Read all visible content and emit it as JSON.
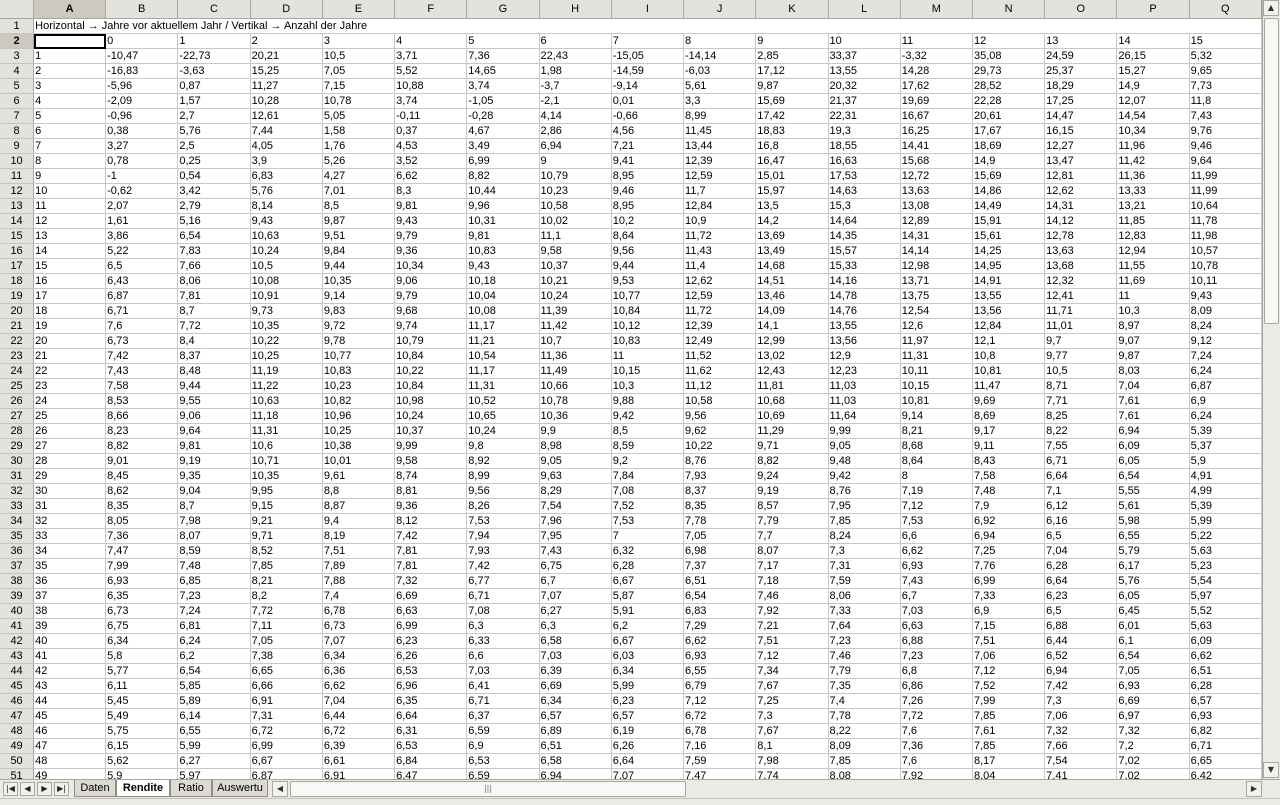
{
  "sheet": {
    "columns": [
      "A",
      "B",
      "C",
      "D",
      "E",
      "F",
      "G",
      "H",
      "I",
      "J",
      "K",
      "L",
      "M",
      "N",
      "O",
      "P",
      "Q"
    ],
    "selected_column": "A",
    "selected_row": 2,
    "title_row": "Horizontal → Jahre vor aktuellem Jahr  /  Vertikal → Anzahl der Jahre",
    "header_row": [
      "",
      "0",
      "1",
      "2",
      "3",
      "4",
      "5",
      "6",
      "7",
      "8",
      "9",
      "10",
      "11",
      "12",
      "13",
      "14",
      "15"
    ],
    "rows": [
      [
        "1",
        "-10,47",
        "-22,73",
        "20,21",
        "10,5",
        "3,71",
        "7,36",
        "22,43",
        "-15,05",
        "-14,14",
        "2,85",
        "33,37",
        "-3,32",
        "35,08",
        "24,59",
        "26,15",
        "5,32"
      ],
      [
        "2",
        "-16,83",
        "-3,63",
        "15,25",
        "7,05",
        "5,52",
        "14,65",
        "1,98",
        "-14,59",
        "-6,03",
        "17,12",
        "13,55",
        "14,28",
        "29,73",
        "25,37",
        "15,27",
        "9,65"
      ],
      [
        "3",
        "-5,96",
        "0,87",
        "11,27",
        "7,15",
        "10,88",
        "3,74",
        "-3,7",
        "-9,14",
        "5,61",
        "9,87",
        "20,32",
        "17,62",
        "28,52",
        "18,29",
        "14,9",
        "7,73"
      ],
      [
        "4",
        "-2,09",
        "1,57",
        "10,28",
        "10,78",
        "3,74",
        "-1,05",
        "-2,1",
        "0,01",
        "3,3",
        "15,69",
        "21,37",
        "19,69",
        "22,28",
        "17,25",
        "12,07",
        "11,8"
      ],
      [
        "5",
        "-0,96",
        "2,7",
        "12,61",
        "5,05",
        "-0,11",
        "-0,28",
        "4,14",
        "-0,66",
        "8,99",
        "17,42",
        "22,31",
        "16,67",
        "20,61",
        "14,47",
        "14,54",
        "7,43"
      ],
      [
        "6",
        "0,38",
        "5,76",
        "7,44",
        "1,58",
        "0,37",
        "4,67",
        "2,86",
        "4,56",
        "11,45",
        "18,83",
        "19,3",
        "16,25",
        "17,67",
        "16,15",
        "10,34",
        "9,76"
      ],
      [
        "7",
        "3,27",
        "2,5",
        "4,05",
        "1,76",
        "4,53",
        "3,49",
        "6,94",
        "7,21",
        "13,44",
        "16,8",
        "18,55",
        "14,41",
        "18,69",
        "12,27",
        "11,96",
        "9,46"
      ],
      [
        "8",
        "0,78",
        "0,25",
        "3,9",
        "5,26",
        "3,52",
        "6,99",
        "9",
        "9,41",
        "12,39",
        "16,47",
        "16,63",
        "15,68",
        "14,9",
        "13,47",
        "11,42",
        "9,64"
      ],
      [
        "9",
        "-1",
        "0,54",
        "6,83",
        "4,27",
        "6,62",
        "8,82",
        "10,79",
        "8,95",
        "12,59",
        "15,01",
        "17,53",
        "12,72",
        "15,69",
        "12,81",
        "11,36",
        "11,99"
      ],
      [
        "10",
        "-0,62",
        "3,42",
        "5,76",
        "7,01",
        "8,3",
        "10,44",
        "10,23",
        "9,46",
        "11,7",
        "15,97",
        "14,63",
        "13,63",
        "14,86",
        "12,62",
        "13,33",
        "11,99"
      ],
      [
        "11",
        "2,07",
        "2,79",
        "8,14",
        "8,5",
        "9,81",
        "9,96",
        "10,58",
        "8,95",
        "12,84",
        "13,5",
        "15,3",
        "13,08",
        "14,49",
        "14,31",
        "13,21",
        "10,64"
      ],
      [
        "12",
        "1,61",
        "5,16",
        "9,43",
        "9,87",
        "9,43",
        "10,31",
        "10,02",
        "10,2",
        "10,9",
        "14,2",
        "14,64",
        "12,89",
        "15,91",
        "14,12",
        "11,85",
        "11,78"
      ],
      [
        "13",
        "3,86",
        "6,54",
        "10,63",
        "9,51",
        "9,79",
        "9,81",
        "11,1",
        "8,64",
        "11,72",
        "13,69",
        "14,35",
        "14,31",
        "15,61",
        "12,78",
        "12,83",
        "11,98"
      ],
      [
        "14",
        "5,22",
        "7,83",
        "10,24",
        "9,84",
        "9,36",
        "10,83",
        "9,58",
        "9,56",
        "11,43",
        "13,49",
        "15,57",
        "14,14",
        "14,25",
        "13,63",
        "12,94",
        "10,57"
      ],
      [
        "15",
        "6,5",
        "7,66",
        "10,5",
        "9,44",
        "10,34",
        "9,43",
        "10,37",
        "9,44",
        "11,4",
        "14,68",
        "15,33",
        "12,98",
        "14,95",
        "13,68",
        "11,55",
        "10,78"
      ],
      [
        "16",
        "6,43",
        "8,06",
        "10,08",
        "10,35",
        "9,06",
        "10,18",
        "10,21",
        "9,53",
        "12,62",
        "14,51",
        "14,16",
        "13,71",
        "14,91",
        "12,32",
        "11,69",
        "10,11"
      ],
      [
        "17",
        "6,87",
        "7,81",
        "10,91",
        "9,14",
        "9,79",
        "10,04",
        "10,24",
        "10,77",
        "12,59",
        "13,46",
        "14,78",
        "13,75",
        "13,55",
        "12,41",
        "11",
        "9,43"
      ],
      [
        "18",
        "6,71",
        "8,7",
        "9,73",
        "9,83",
        "9,68",
        "10,08",
        "11,39",
        "10,84",
        "11,72",
        "14,09",
        "14,76",
        "12,54",
        "13,56",
        "11,71",
        "10,3",
        "8,09"
      ],
      [
        "19",
        "7,6",
        "7,72",
        "10,35",
        "9,72",
        "9,74",
        "11,17",
        "11,42",
        "10,12",
        "12,39",
        "14,1",
        "13,55",
        "12,6",
        "12,84",
        "11,01",
        "8,97",
        "8,24"
      ],
      [
        "20",
        "6,73",
        "8,4",
        "10,22",
        "9,78",
        "10,79",
        "11,21",
        "10,7",
        "10,83",
        "12,49",
        "12,99",
        "13,56",
        "11,97",
        "12,1",
        "9,7",
        "9,07",
        "9,12"
      ],
      [
        "21",
        "7,42",
        "8,37",
        "10,25",
        "10,77",
        "10,84",
        "10,54",
        "11,36",
        "11",
        "11,52",
        "13,02",
        "12,9",
        "11,31",
        "10,8",
        "9,77",
        "9,87",
        "7,24"
      ],
      [
        "22",
        "7,43",
        "8,48",
        "11,19",
        "10,83",
        "10,22",
        "11,17",
        "11,49",
        "10,15",
        "11,62",
        "12,43",
        "12,23",
        "10,11",
        "10,81",
        "10,5",
        "8,03",
        "6,24"
      ],
      [
        "23",
        "7,58",
        "9,44",
        "11,22",
        "10,23",
        "10,84",
        "11,31",
        "10,66",
        "10,3",
        "11,12",
        "11,81",
        "11,03",
        "10,15",
        "11,47",
        "8,71",
        "7,04",
        "6,87"
      ],
      [
        "24",
        "8,53",
        "9,55",
        "10,63",
        "10,82",
        "10,98",
        "10,52",
        "10,78",
        "9,88",
        "10,58",
        "10,68",
        "11,03",
        "10,81",
        "9,69",
        "7,71",
        "7,61",
        "6,9"
      ],
      [
        "25",
        "8,66",
        "9,06",
        "11,18",
        "10,96",
        "10,24",
        "10,65",
        "10,36",
        "9,42",
        "9,56",
        "10,69",
        "11,64",
        "9,14",
        "8,69",
        "8,25",
        "7,61",
        "6,24"
      ],
      [
        "26",
        "8,23",
        "9,64",
        "11,31",
        "10,25",
        "10,37",
        "10,24",
        "9,9",
        "8,5",
        "9,62",
        "11,29",
        "9,99",
        "8,21",
        "9,17",
        "8,22",
        "6,94",
        "5,39"
      ],
      [
        "27",
        "8,82",
        "9,81",
        "10,6",
        "10,38",
        "9,99",
        "9,8",
        "8,98",
        "8,59",
        "10,22",
        "9,71",
        "9,05",
        "8,68",
        "9,11",
        "7,55",
        "6,09",
        "5,37"
      ],
      [
        "28",
        "9,01",
        "9,19",
        "10,71",
        "10,01",
        "9,58",
        "8,92",
        "9,05",
        "9,2",
        "8,76",
        "8,82",
        "9,48",
        "8,64",
        "8,43",
        "6,71",
        "6,05",
        "5,9"
      ],
      [
        "29",
        "8,45",
        "9,35",
        "10,35",
        "9,61",
        "8,74",
        "8,99",
        "9,63",
        "7,84",
        "7,93",
        "9,24",
        "9,42",
        "8",
        "7,58",
        "6,64",
        "6,54",
        "4,91"
      ],
      [
        "30",
        "8,62",
        "9,04",
        "9,95",
        "8,8",
        "8,81",
        "9,56",
        "8,29",
        "7,08",
        "8,37",
        "9,19",
        "8,76",
        "7,19",
        "7,48",
        "7,1",
        "5,55",
        "4,99"
      ],
      [
        "31",
        "8,35",
        "8,7",
        "9,15",
        "8,87",
        "9,36",
        "8,26",
        "7,54",
        "7,52",
        "8,35",
        "8,57",
        "7,95",
        "7,12",
        "7,9",
        "6,12",
        "5,61",
        "5,39"
      ],
      [
        "32",
        "8,05",
        "7,98",
        "9,21",
        "9,4",
        "8,12",
        "7,53",
        "7,96",
        "7,53",
        "7,78",
        "7,79",
        "7,85",
        "7,53",
        "6,92",
        "6,16",
        "5,98",
        "5,99"
      ],
      [
        "33",
        "7,36",
        "8,07",
        "9,71",
        "8,19",
        "7,42",
        "7,94",
        "7,95",
        "7",
        "7,05",
        "7,7",
        "8,24",
        "6,6",
        "6,94",
        "6,5",
        "6,55",
        "5,22"
      ],
      [
        "34",
        "7,47",
        "8,59",
        "8,52",
        "7,51",
        "7,81",
        "7,93",
        "7,43",
        "6,32",
        "6,98",
        "8,07",
        "7,3",
        "6,62",
        "7,25",
        "7,04",
        "5,79",
        "5,63"
      ],
      [
        "35",
        "7,99",
        "7,48",
        "7,85",
        "7,89",
        "7,81",
        "7,42",
        "6,75",
        "6,28",
        "7,37",
        "7,17",
        "7,31",
        "6,93",
        "7,76",
        "6,28",
        "6,17",
        "5,23"
      ],
      [
        "36",
        "6,93",
        "6,85",
        "8,21",
        "7,88",
        "7,32",
        "6,77",
        "6,7",
        "6,67",
        "6,51",
        "7,18",
        "7,59",
        "7,43",
        "6,99",
        "6,64",
        "5,76",
        "5,54"
      ],
      [
        "37",
        "6,35",
        "7,23",
        "8,2",
        "7,4",
        "6,69",
        "6,71",
        "7,07",
        "5,87",
        "6,54",
        "7,46",
        "8,06",
        "6,7",
        "7,33",
        "6,23",
        "6,05",
        "5,97"
      ],
      [
        "38",
        "6,73",
        "7,24",
        "7,72",
        "6,78",
        "6,63",
        "7,08",
        "6,27",
        "5,91",
        "6,83",
        "7,92",
        "7,33",
        "7,03",
        "6,9",
        "6,5",
        "6,45",
        "5,52"
      ],
      [
        "39",
        "6,75",
        "6,81",
        "7,11",
        "6,73",
        "6,99",
        "6,3",
        "6,3",
        "6,2",
        "7,29",
        "7,21",
        "7,64",
        "6,63",
        "7,15",
        "6,88",
        "6,01",
        "5,63"
      ],
      [
        "40",
        "6,34",
        "6,24",
        "7,05",
        "7,07",
        "6,23",
        "6,33",
        "6,58",
        "6,67",
        "6,62",
        "7,51",
        "7,23",
        "6,88",
        "7,51",
        "6,44",
        "6,1",
        "6,09"
      ],
      [
        "41",
        "5,8",
        "6,2",
        "7,38",
        "6,34",
        "6,26",
        "6,6",
        "7,03",
        "6,03",
        "6,93",
        "7,12",
        "7,46",
        "7,23",
        "7,06",
        "6,52",
        "6,54",
        "6,62"
      ],
      [
        "42",
        "5,77",
        "6,54",
        "6,65",
        "6,36",
        "6,53",
        "7,03",
        "6,39",
        "6,34",
        "6,55",
        "7,34",
        "7,79",
        "6,8",
        "7,12",
        "6,94",
        "7,05",
        "6,51"
      ],
      [
        "43",
        "6,11",
        "5,85",
        "6,66",
        "6,62",
        "6,96",
        "6,41",
        "6,69",
        "5,99",
        "6,79",
        "7,67",
        "7,35",
        "6,86",
        "7,52",
        "7,42",
        "6,93",
        "6,28"
      ],
      [
        "44",
        "5,45",
        "5,89",
        "6,91",
        "7,04",
        "6,35",
        "6,71",
        "6,34",
        "6,23",
        "7,12",
        "7,25",
        "7,4",
        "7,26",
        "7,99",
        "7,3",
        "6,69",
        "6,57"
      ],
      [
        "45",
        "5,49",
        "6,14",
        "7,31",
        "6,44",
        "6,64",
        "6,37",
        "6,57",
        "6,57",
        "6,72",
        "7,3",
        "7,78",
        "7,72",
        "7,85",
        "7,06",
        "6,97",
        "6,93"
      ],
      [
        "46",
        "5,75",
        "6,55",
        "6,72",
        "6,72",
        "6,31",
        "6,59",
        "6,89",
        "6,19",
        "6,78",
        "7,67",
        "8,22",
        "7,6",
        "7,61",
        "7,32",
        "7,32",
        "6,82"
      ],
      [
        "47",
        "6,15",
        "5,99",
        "6,99",
        "6,39",
        "6,53",
        "6,9",
        "6,51",
        "6,26",
        "7,16",
        "8,1",
        "8,09",
        "7,36",
        "7,85",
        "7,66",
        "7,2",
        "6,71"
      ],
      [
        "48",
        "5,62",
        "6,27",
        "6,67",
        "6,61",
        "6,84",
        "6,53",
        "6,58",
        "6,64",
        "7,59",
        "7,98",
        "7,85",
        "7,6",
        "8,17",
        "7,54",
        "7,02",
        "6,65"
      ],
      [
        "49",
        "5,9",
        "5,97",
        "6,87",
        "6,91",
        "6,47",
        "6,59",
        "6,94",
        "7,07",
        "7,47",
        "7,74",
        "8,08",
        "7,92",
        "8,04",
        "7,41",
        "7,02",
        "6,42"
      ]
    ]
  },
  "tabs": [
    {
      "label": "Daten",
      "active": false
    },
    {
      "label": "Rendite",
      "active": true
    },
    {
      "label": "Ratio",
      "active": false
    },
    {
      "label": "Auswertu",
      "active": false
    }
  ],
  "colors": {
    "header_bg": "#e4e2dc",
    "selected_header_bg": "#ccc9bf",
    "grid_line": "#c8c8c8"
  }
}
